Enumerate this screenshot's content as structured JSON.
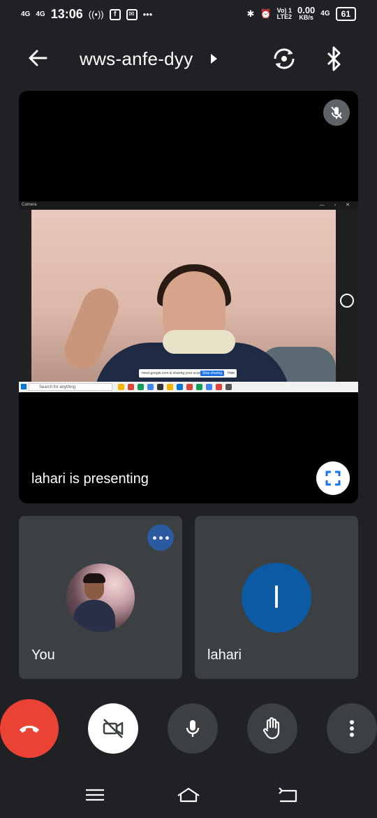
{
  "status_bar": {
    "net1": "4G",
    "net2": "4G",
    "time": "13:06",
    "volte": "Vo) 1",
    "lte": "LTE2",
    "speed_value": "0.00",
    "speed_unit": "KB/s",
    "net3": "4G",
    "battery": "61"
  },
  "header": {
    "meeting_code": "wws-anfe-dyy"
  },
  "presentation": {
    "camera_app_label": "Camera",
    "window_controls": "— ▫ ✕",
    "taskbar_search": "Search for anything",
    "share_banner_text": "meet.google.com is sharing your screen.",
    "stop_sharing": "Stop sharing",
    "hide": "Hide",
    "presenting_label": "lahari is presenting"
  },
  "participants": [
    {
      "name": "You",
      "avatar": "photo"
    },
    {
      "name": "lahari",
      "avatar_letter": "l",
      "avatar_color": "#0b5aa3"
    }
  ],
  "colors": {
    "background": "#202124",
    "tile": "#3c4043",
    "hangup": "#ea4335",
    "more_button": "#2c5aa0"
  },
  "icons": {
    "back": "arrow-left-icon",
    "switch_camera": "switch-camera-icon",
    "bluetooth": "bluetooth-icon",
    "muted": "mic-off-icon",
    "fullscreen": "fullscreen-icon",
    "hangup": "phone-hangup-icon",
    "camera_off": "video-off-icon",
    "mic": "mic-icon",
    "raise_hand": "hand-icon",
    "more": "more-vertical-icon"
  }
}
